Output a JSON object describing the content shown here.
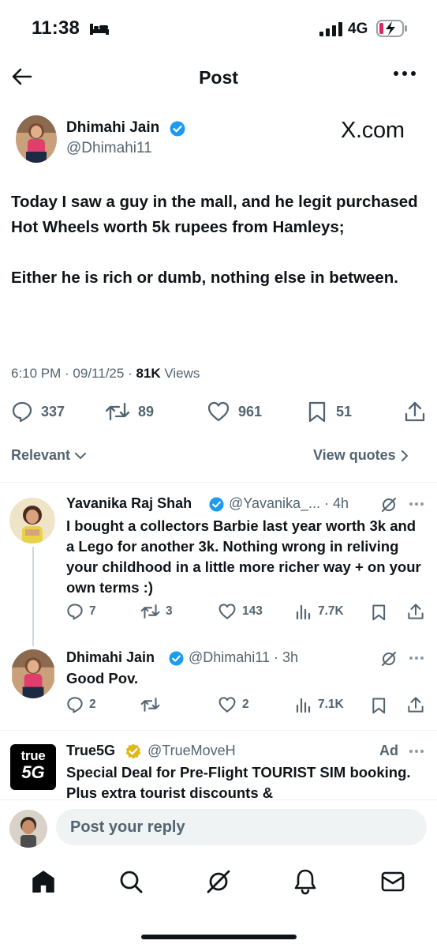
{
  "status_bar": {
    "time": "11:38",
    "network": "4G"
  },
  "header": {
    "title": "Post"
  },
  "author": {
    "name": "Dhimahi Jain",
    "handle": "@Dhimahi11",
    "watermark": "X.com"
  },
  "tweet": {
    "text": "Today I saw a guy in the mall, and he legit purchased Hot Wheels worth 5k rupees from Hamleys;\n\nEither he is rich or dumb, nothing else in between.",
    "time": "6:10 PM",
    "date": "09/11/25",
    "views_count": "81K",
    "views_label": "Views",
    "replies": "337",
    "retweets": "89",
    "likes": "961",
    "bookmarks": "51"
  },
  "filters": {
    "sort": "Relevant",
    "quotes": "View quotes"
  },
  "replies": [
    {
      "name": "Yavanika Raj Shah",
      "handle": "@Yavanika_... · 4h",
      "text": "I bought a collectors Barbie last year worth 3k and a Lego for another 3k. Nothing wrong in reliving your childhood in a little more richer way + on your own terms :)",
      "replies": "7",
      "retweets": "3",
      "likes": "143",
      "views": "7.7K"
    },
    {
      "name": "Dhimahi Jain",
      "handle": "@Dhimahi11 · 3h",
      "text": "Good Pov.",
      "replies": "2",
      "retweets": "",
      "likes": "2",
      "views": "7.1K"
    }
  ],
  "ad": {
    "logo_top": "true",
    "logo_bottom": "5G",
    "name": "True5G",
    "handle": "@TrueMoveH",
    "badge": "Ad",
    "text": "Special Deal for Pre-Flight TOURIST SIM booking. Plus extra tourist discounts &"
  },
  "reply_bar": {
    "placeholder": "Post your reply"
  },
  "colors": {
    "verified_blue": "#1d9bf0",
    "gold_badge": "#e2b719",
    "secondary_text": "#536471"
  }
}
